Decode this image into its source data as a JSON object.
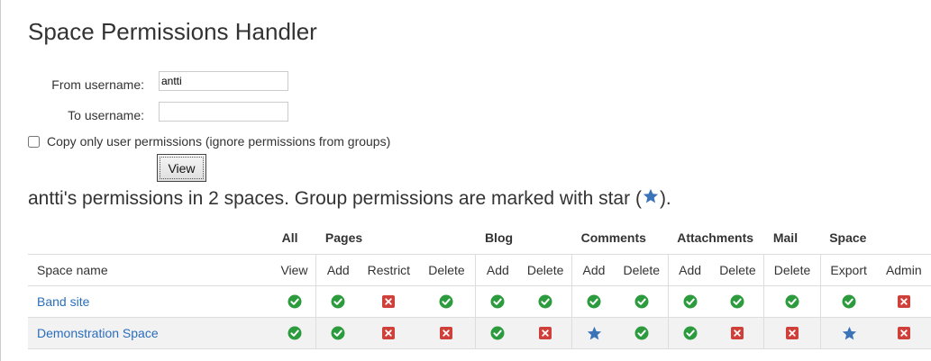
{
  "page": {
    "title": "Space Permissions Handler"
  },
  "form": {
    "from_label": "From username:",
    "from_value": "antti",
    "to_label": "To username:",
    "to_value": "",
    "checkbox_label": "Copy only user permissions (ignore permissions from groups)",
    "checkbox_checked": false,
    "view_button": "View"
  },
  "summary": {
    "text_before": "antti's permissions in 2 spaces. Group permissions are marked with star (",
    "text_after": ")."
  },
  "colors": {
    "allowed": "#2c9b3e",
    "denied": "#d0403a",
    "group": "#3b73b9",
    "link": "#2a6ebb"
  },
  "table": {
    "groups": [
      {
        "label": "",
        "span": 1
      },
      {
        "label": "All",
        "span": 1
      },
      {
        "label": "Pages",
        "span": 3
      },
      {
        "label": "Blog",
        "span": 2
      },
      {
        "label": "Comments",
        "span": 2
      },
      {
        "label": "Attachments",
        "span": 2
      },
      {
        "label": "Mail",
        "span": 1
      },
      {
        "label": "Space",
        "span": 2
      }
    ],
    "columns": [
      "Space name",
      "View",
      "Add",
      "Restrict",
      "Delete",
      "Add",
      "Delete",
      "Add",
      "Delete",
      "Add",
      "Delete",
      "Delete",
      "Export",
      "Admin"
    ],
    "rows": [
      {
        "space": "Band site",
        "perms": [
          "check-icon",
          "check-icon",
          "cross-icon",
          "check-icon",
          "check-icon",
          "check-icon",
          "check-icon",
          "check-icon",
          "check-icon",
          "check-icon",
          "check-icon",
          "check-icon",
          "cross-icon"
        ]
      },
      {
        "space": "Demonstration Space",
        "perms": [
          "check-icon",
          "check-icon",
          "cross-icon",
          "cross-icon",
          "check-icon",
          "cross-icon",
          "star-icon",
          "check-icon",
          "check-icon",
          "cross-icon",
          "cross-icon",
          "star-icon",
          "cross-icon"
        ]
      }
    ]
  }
}
